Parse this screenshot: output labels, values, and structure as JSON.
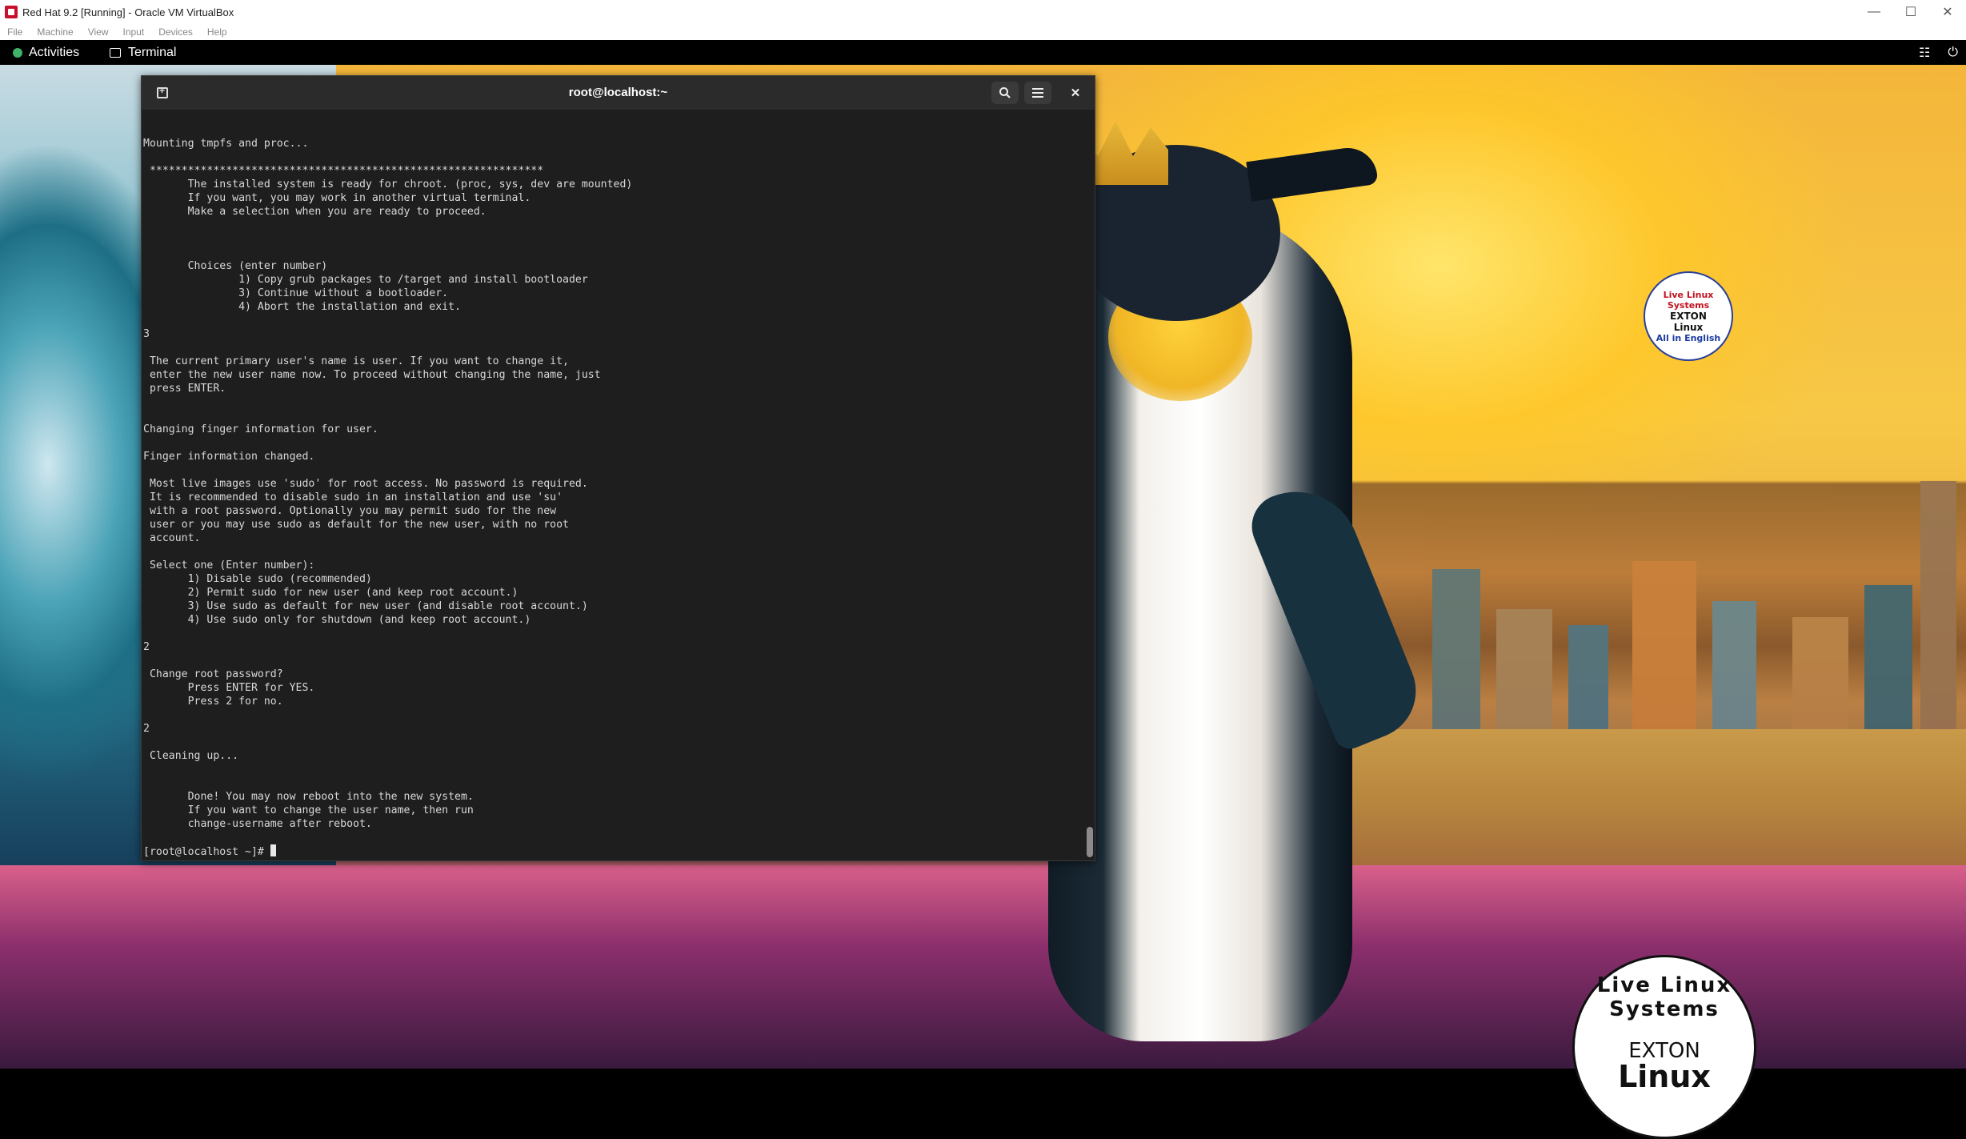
{
  "vbox": {
    "title": "Red Hat 9.2 [Running] - Oracle VM VirtualBox",
    "menu": [
      "File",
      "Machine",
      "View",
      "Input",
      "Devices",
      "Help"
    ]
  },
  "topbar": {
    "activities": "Activities",
    "app_name": "Terminal"
  },
  "terminal": {
    "title": "root@localhost:~",
    "lines": [
      "",
      "",
      "Mounting tmpfs and proc...",
      "",
      " **************************************************************",
      "       The installed system is ready for chroot. (proc, sys, dev are mounted)",
      "       If you want, you may work in another virtual terminal.",
      "       Make a selection when you are ready to proceed.",
      "",
      "",
      "",
      "       Choices (enter number)",
      "               1) Copy grub packages to /target and install bootloader",
      "               3) Continue without a bootloader.",
      "               4) Abort the installation and exit.",
      "",
      "3",
      "",
      " The current primary user's name is user. If you want to change it,",
      " enter the new user name now. To proceed without changing the name, just",
      " press ENTER.",
      "",
      "",
      "Changing finger information for user.",
      "",
      "Finger information changed.",
      "",
      " Most live images use 'sudo' for root access. No password is required.",
      " It is recommended to disable sudo in an installation and use 'su'",
      " with a root password. Optionally you may permit sudo for the new",
      " user or you may use sudo as default for the new user, with no root",
      " account.",
      "",
      " Select one (Enter number):",
      "       1) Disable sudo (recommended)",
      "       2) Permit sudo for new user (and keep root account.)",
      "       3) Use sudo as default for new user (and disable root account.)",
      "       4) Use sudo only for shutdown (and keep root account.)",
      "",
      "2",
      "",
      " Change root password?",
      "       Press ENTER for YES.",
      "       Press 2 for no.",
      "",
      "2",
      "",
      " Cleaning up...",
      "",
      "",
      "       Done! You may now reboot into the new system.",
      "       If you want to change the user name, then run",
      "       change-username after reboot.",
      ""
    ],
    "prompt": "[root@localhost ~]# "
  },
  "wallpaper": {
    "badge_small": {
      "top": "Live Linux Systems",
      "line1": "EXTON",
      "line2": "Linux",
      "bottom": "All in English"
    },
    "badge_large": {
      "top": "Live Linux Systems",
      "line1": "EXTON",
      "line2": "Linux"
    }
  },
  "icons": {
    "new_tab": "new-tab-icon",
    "search": "search-icon",
    "menu": "hamburger-menu-icon",
    "close": "close-icon",
    "network": "network-icon",
    "power": "power-icon"
  }
}
